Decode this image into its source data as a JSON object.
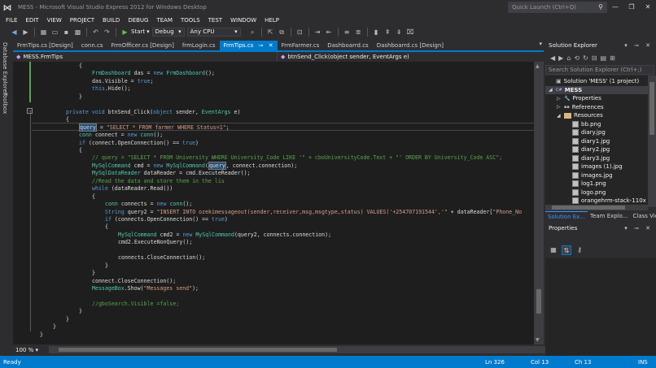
{
  "window": {
    "title": "MESS - Microsoft Visual Studio Express 2012 for Windows Desktop",
    "quick_launch_placeholder": "Quick Launch (Ctrl+Q)"
  },
  "menu": [
    "FILE",
    "EDIT",
    "VIEW",
    "PROJECT",
    "BUILD",
    "DEBUG",
    "TEAM",
    "TOOLS",
    "TEST",
    "WINDOW",
    "HELP"
  ],
  "toolbar": {
    "start_label": "Start",
    "config": "Debug",
    "platform": "Any CPU"
  },
  "left_strip": [
    "Database Explorer",
    "Toolbox"
  ],
  "doc_tabs": [
    {
      "label": "FrmTips.cs [Design]",
      "active": false
    },
    {
      "label": "conn.cs",
      "active": false
    },
    {
      "label": "FrmOfficer.cs [Design]",
      "active": false
    },
    {
      "label": "frmLogin.cs",
      "active": false
    },
    {
      "label": "FrmTips.cs",
      "active": true
    },
    {
      "label": "FrmFarmer.cs",
      "active": false
    },
    {
      "label": "Dashboarrd.cs",
      "active": false
    },
    {
      "label": "Dashboarrd.cs [Design]",
      "active": false
    }
  ],
  "nav": {
    "type": "MESS.FrmTips",
    "member": "btnSend_Click(object sender, EventArgs e)"
  },
  "code": [
    {
      "indent": 12,
      "parts": [
        [
          "p",
          "{"
        ]
      ]
    },
    {
      "indent": 16,
      "parts": [
        [
          "t",
          "FrmDashboard"
        ],
        [
          "p",
          " das = "
        ],
        [
          "k",
          "new"
        ],
        [
          "p",
          " "
        ],
        [
          "t",
          "FrmDashboard"
        ],
        [
          "p",
          "();"
        ]
      ]
    },
    {
      "indent": 16,
      "parts": [
        [
          "p",
          "das.Visible = "
        ],
        [
          "k",
          "true"
        ],
        [
          "p",
          ";"
        ]
      ]
    },
    {
      "indent": 16,
      "parts": [
        [
          "k",
          "this"
        ],
        [
          "p",
          ".Hide();"
        ]
      ]
    },
    {
      "indent": 12,
      "parts": [
        [
          "p",
          "}"
        ]
      ]
    },
    {
      "indent": 0,
      "parts": []
    },
    {
      "indent": 8,
      "parts": [
        [
          "k",
          "private"
        ],
        [
          "p",
          " "
        ],
        [
          "k",
          "void"
        ],
        [
          "p",
          " btnSend_Click("
        ],
        [
          "k",
          "object"
        ],
        [
          "p",
          " sender, "
        ],
        [
          "t",
          "EventArgs"
        ],
        [
          "p",
          " e)"
        ]
      ]
    },
    {
      "indent": 8,
      "parts": [
        [
          "p",
          "{"
        ]
      ]
    },
    {
      "indent": 12,
      "parts": [
        [
          "h",
          "query"
        ],
        [
          "p",
          " = "
        ],
        [
          "s",
          "\"SELECT * FROM farmer WHERE Status=1\""
        ],
        [
          "p",
          ";"
        ]
      ]
    },
    {
      "indent": 12,
      "parts": [
        [
          "t",
          "conn"
        ],
        [
          "p",
          " connect = "
        ],
        [
          "k",
          "new"
        ],
        [
          "p",
          " "
        ],
        [
          "t",
          "conn"
        ],
        [
          "p",
          "();"
        ]
      ]
    },
    {
      "indent": 12,
      "parts": [
        [
          "k",
          "if"
        ],
        [
          "p",
          " (connect.OpenConnection() == "
        ],
        [
          "k",
          "true"
        ],
        [
          "p",
          ")"
        ]
      ]
    },
    {
      "indent": 12,
      "parts": [
        [
          "p",
          "{"
        ]
      ]
    },
    {
      "indent": 16,
      "parts": [
        [
          "c",
          "// query = \"SELECT * FROM University WHERE University_Code LIKE '\" + cboUniversityCode.Text + \"' ORDER BY University_Code ASC\";"
        ]
      ]
    },
    {
      "indent": 16,
      "parts": [
        [
          "t",
          "MySqlCommand"
        ],
        [
          "p",
          " cmd = "
        ],
        [
          "k",
          "new"
        ],
        [
          "p",
          " "
        ],
        [
          "t",
          "MySqlCommand"
        ],
        [
          "p",
          "("
        ],
        [
          "h",
          "query"
        ],
        [
          "p",
          ", connect.connection);"
        ]
      ]
    },
    {
      "indent": 16,
      "parts": [
        [
          "t",
          "MySqlDataReader"
        ],
        [
          "p",
          " dataReader = cmd.ExecuteReader();"
        ]
      ]
    },
    {
      "indent": 16,
      "parts": [
        [
          "c",
          "//Read the data and store them in the lis"
        ]
      ]
    },
    {
      "indent": 16,
      "parts": [
        [
          "k",
          "while"
        ],
        [
          "p",
          " (dataReader.Read())"
        ]
      ]
    },
    {
      "indent": 16,
      "parts": [
        [
          "p",
          "{"
        ]
      ]
    },
    {
      "indent": 20,
      "parts": [
        [
          "t",
          "conn"
        ],
        [
          "p",
          " connects = "
        ],
        [
          "k",
          "new"
        ],
        [
          "p",
          " "
        ],
        [
          "t",
          "conn"
        ],
        [
          "p",
          "();"
        ]
      ]
    },
    {
      "indent": 20,
      "parts": [
        [
          "k",
          "String"
        ],
        [
          "p",
          " query2 = "
        ],
        [
          "s",
          "\"INSERT INTO ozekimessageout(sender,receiver,msg,msgtype,status) VALUES('+254707191544','\""
        ],
        [
          "p",
          " + dataReader["
        ],
        [
          "s",
          "\"Phone_No"
        ]
      ]
    },
    {
      "indent": 20,
      "parts": [
        [
          "k",
          "if"
        ],
        [
          "p",
          " (connects.OpenConnection() == "
        ],
        [
          "k",
          "true"
        ],
        [
          "p",
          ")"
        ]
      ]
    },
    {
      "indent": 20,
      "parts": [
        [
          "p",
          "{"
        ]
      ]
    },
    {
      "indent": 24,
      "parts": [
        [
          "t",
          "MySqlCommand"
        ],
        [
          "p",
          " cmd2 = "
        ],
        [
          "k",
          "new"
        ],
        [
          "p",
          " "
        ],
        [
          "t",
          "MySqlCommand"
        ],
        [
          "p",
          "(query2, connects.connection);"
        ]
      ]
    },
    {
      "indent": 24,
      "parts": [
        [
          "p",
          "cmd2.ExecuteNonQuery();"
        ]
      ]
    },
    {
      "indent": 0,
      "parts": []
    },
    {
      "indent": 24,
      "parts": [
        [
          "p",
          "connects.CloseConnection();"
        ]
      ]
    },
    {
      "indent": 20,
      "parts": [
        [
          "p",
          "}"
        ]
      ]
    },
    {
      "indent": 16,
      "parts": [
        [
          "p",
          "}"
        ]
      ]
    },
    {
      "indent": 16,
      "parts": [
        [
          "p",
          "connect.CloseConnection();"
        ]
      ]
    },
    {
      "indent": 16,
      "parts": [
        [
          "t",
          "MessageBox"
        ],
        [
          "p",
          ".Show("
        ],
        [
          "s",
          "\"Messages send\""
        ],
        [
          "p",
          ");"
        ]
      ]
    },
    {
      "indent": 0,
      "parts": []
    },
    {
      "indent": 16,
      "parts": [
        [
          "c",
          "//gboSearch.Visible =false;"
        ]
      ]
    },
    {
      "indent": 12,
      "parts": [
        [
          "p",
          "}"
        ]
      ]
    },
    {
      "indent": 8,
      "parts": [
        [
          "p",
          "}"
        ]
      ]
    },
    {
      "indent": 4,
      "parts": [
        [
          "p",
          "}"
        ]
      ]
    },
    {
      "indent": 0,
      "parts": [
        [
          "p",
          "}"
        ]
      ]
    }
  ],
  "editor": {
    "zoom": "100 %"
  },
  "solution_explorer": {
    "title": "Solution Explorer",
    "search_placeholder": "Search Solution Explorer (Ctrl+;)",
    "tree": [
      {
        "label": "Solution 'MESS' (1 project)",
        "level": 0,
        "kind": "solution",
        "arrow": ""
      },
      {
        "label": "MESS",
        "level": 0,
        "kind": "project",
        "arrow": "◢",
        "selected": true
      },
      {
        "label": "Properties",
        "level": 1,
        "kind": "props",
        "arrow": "▷"
      },
      {
        "label": "References",
        "level": 1,
        "kind": "refs",
        "arrow": "▷"
      },
      {
        "label": "Resources",
        "level": 1,
        "kind": "folder",
        "arrow": "◢"
      },
      {
        "label": "bb.png",
        "level": 2,
        "kind": "file",
        "arrow": ""
      },
      {
        "label": "diary.jpg",
        "level": 2,
        "kind": "file",
        "arrow": ""
      },
      {
        "label": "diary1.jpg",
        "level": 2,
        "kind": "file",
        "arrow": ""
      },
      {
        "label": "diary2.jpg",
        "level": 2,
        "kind": "file",
        "arrow": ""
      },
      {
        "label": "diary3.jpg",
        "level": 2,
        "kind": "file",
        "arrow": ""
      },
      {
        "label": "images (1).jpg",
        "level": 2,
        "kind": "file",
        "arrow": ""
      },
      {
        "label": "images.jpg",
        "level": 2,
        "kind": "file",
        "arrow": ""
      },
      {
        "label": "log1.png",
        "level": 2,
        "kind": "file",
        "arrow": ""
      },
      {
        "label": "logo.png",
        "level": 2,
        "kind": "file",
        "arrow": ""
      },
      {
        "label": "orangehrm-stack-110x",
        "level": 2,
        "kind": "file",
        "arrow": ""
      }
    ],
    "tabs": [
      "Solution Ex...",
      "Team Explo...",
      "Class View"
    ]
  },
  "properties": {
    "title": "Properties"
  },
  "status": {
    "ready": "Ready",
    "line": "Ln 326",
    "col": "Col 13",
    "ch": "Ch 13",
    "mode": "INS"
  },
  "colors": {
    "accent": "#007acc",
    "keyword": "#569cd6",
    "type": "#4ec9b0",
    "string": "#d69d85",
    "comment": "#57a64a"
  }
}
